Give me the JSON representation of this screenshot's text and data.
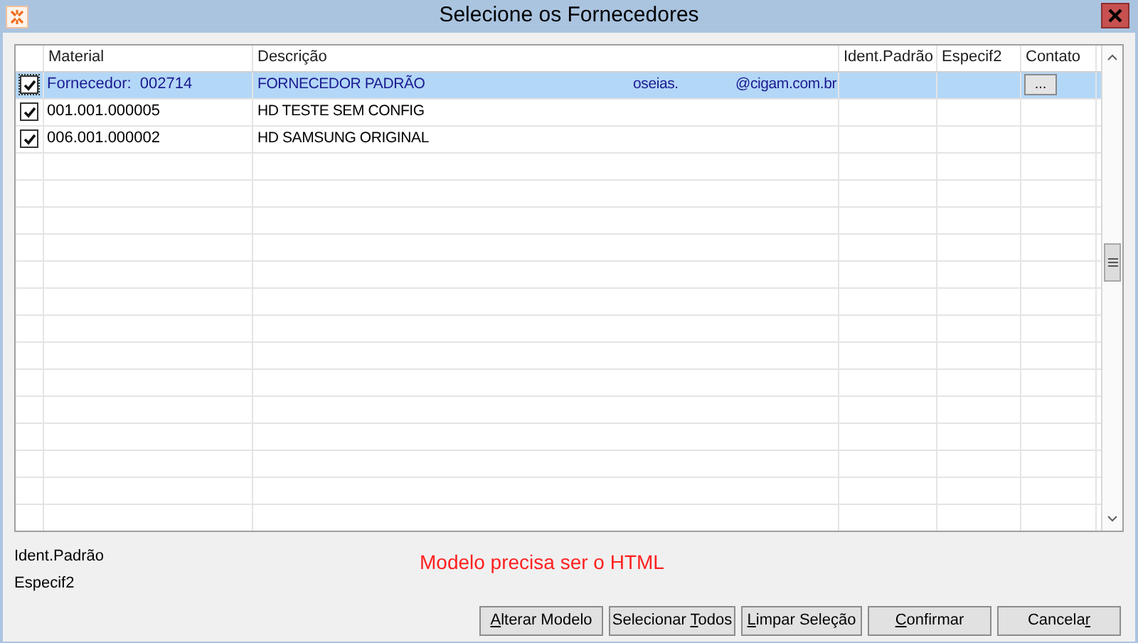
{
  "window": {
    "title": "Selecione os Fornecedores"
  },
  "table": {
    "columns": [
      "Material",
      "Descrição",
      "Ident.Padrão",
      "Especif2",
      "Contato"
    ],
    "rows": [
      {
        "selected": true,
        "checked": true,
        "material": "Fornecedor:  002714",
        "description": [
          "FORNECEDOR PADRÃO",
          "oseias.",
          "@cigam.com.br"
        ],
        "contact": "..."
      },
      {
        "selected": false,
        "checked": true,
        "material": "001.001.000005",
        "description": [
          "HD TESTE SEM CONFIG"
        ]
      },
      {
        "selected": false,
        "checked": true,
        "material": "006.001.000002",
        "description": [
          "HD SAMSUNG ORIGINAL"
        ]
      }
    ]
  },
  "labels": [
    "Ident.Padrão",
    "Especif2"
  ],
  "message": "Modelo precisa ser o HTML",
  "buttons": [
    {
      "key": "A",
      "after": "lterar Modelo"
    },
    {
      "before": "Selecionar ",
      "key": "T",
      "after": "odos"
    },
    {
      "key": "L",
      "after": "impar Seleção"
    },
    {
      "key": "C",
      "after": "onfirmar"
    },
    {
      "before": "Cancela",
      "key": "r"
    }
  ]
}
